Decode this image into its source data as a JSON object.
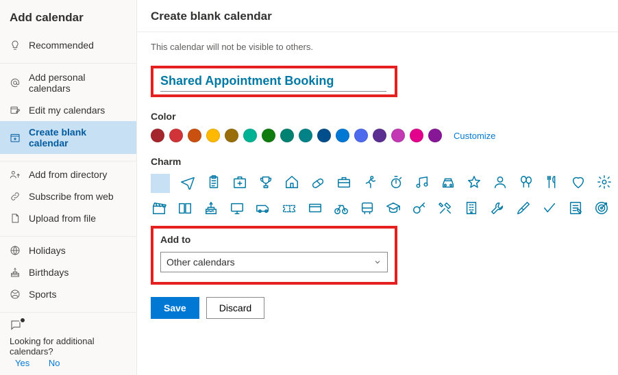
{
  "sidebar": {
    "title": "Add calendar",
    "items": [
      {
        "label": "Recommended"
      },
      {
        "label": "Add personal calendars"
      },
      {
        "label": "Edit my calendars"
      },
      {
        "label": "Create blank calendar"
      },
      {
        "label": "Add from directory"
      },
      {
        "label": "Subscribe from web"
      },
      {
        "label": "Upload from file"
      },
      {
        "label": "Holidays"
      },
      {
        "label": "Birthdays"
      },
      {
        "label": "Sports"
      }
    ],
    "footer_text": "Looking for additional calendars?",
    "footer_yes": "Yes",
    "footer_no": "No"
  },
  "main": {
    "title": "Create blank calendar",
    "subtext": "This calendar will not be visible to others.",
    "calendar_name": "Shared Appointment Booking",
    "color_label": "Color",
    "customize": "Customize",
    "charm_label": "Charm",
    "addto_label": "Add to",
    "addto_value": "Other calendars",
    "save": "Save",
    "discard": "Discard",
    "colors": [
      "#a4262c",
      "#d13438",
      "#ca5010",
      "#ffb900",
      "#986f0b",
      "#00b294",
      "#107c10",
      "#008272",
      "#038387",
      "#004e8c",
      "#0078d4",
      "#4f6bed",
      "#5c2e91",
      "#c239b3",
      "#e3008c",
      "#881798"
    ]
  }
}
